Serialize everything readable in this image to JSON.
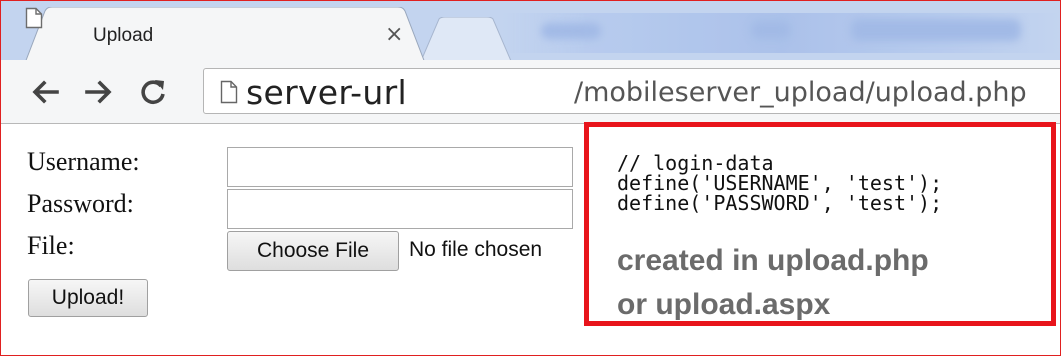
{
  "tab": {
    "title": "Upload",
    "close_glyph": "×",
    "favicon": "page-icon"
  },
  "toolbar": {
    "back_icon": "arrow-left-icon",
    "forward_icon": "arrow-right-icon",
    "reload_icon": "reload-icon"
  },
  "address_bar": {
    "host": "server-url",
    "path": "/mobileserver_upload/upload.php"
  },
  "form": {
    "username_label": "Username:",
    "password_label": "Password:",
    "file_label": "File:",
    "username_value": "",
    "password_value": "",
    "choose_file_label": "Choose File",
    "no_file_text": "No file chosen",
    "upload_label": "Upload!"
  },
  "annotation": {
    "code_lines": [
      "// login-data",
      "define('USERNAME', 'test');",
      "define('PASSWORD', 'test');"
    ],
    "note_lines": [
      "created in upload.php",
      "or upload.aspx"
    ],
    "border_color": "#e8141b"
  }
}
